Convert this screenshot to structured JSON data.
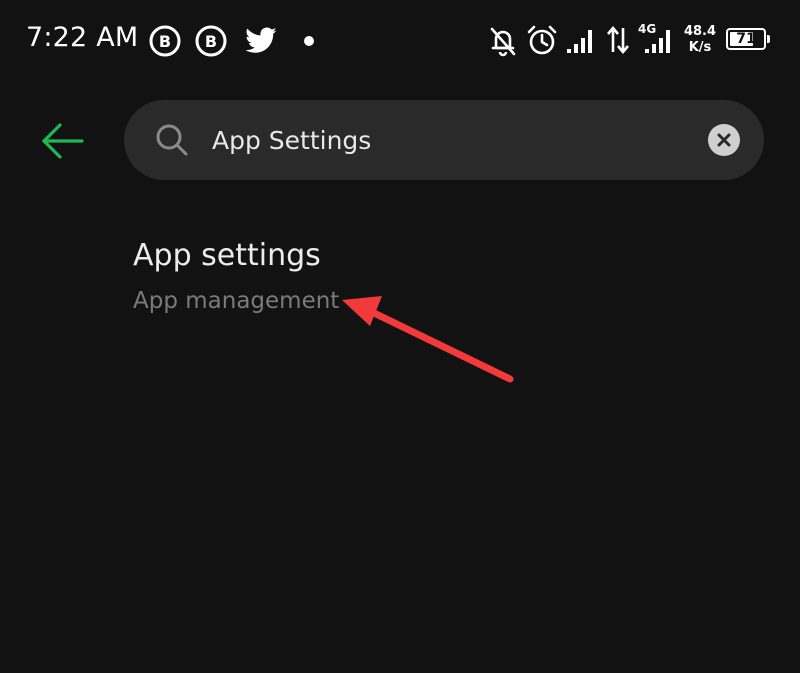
{
  "status_bar": {
    "time": "7:22 AM",
    "notification_icons": [
      "business-b-icon",
      "business-b-icon",
      "twitter-bird-icon",
      "more-dot-icon"
    ],
    "system_icons": [
      "bell-off-icon",
      "alarm-icon",
      "signal-bars-icon",
      "data-arrows-icon",
      "signal-bars-icon"
    ],
    "network_type": "4G",
    "network_speed_value": "48.4",
    "network_speed_unit": "K/s",
    "battery_level": "71",
    "battery_fraction": 0.71
  },
  "header": {
    "back_icon": "arrow-left-icon",
    "search": {
      "value": "App Settings",
      "search_icon": "magnifier-icon",
      "clear_icon": "close-circle-icon"
    }
  },
  "results": [
    {
      "title": "App settings",
      "subtitle": "App management"
    }
  ],
  "colors": {
    "background": "#121212",
    "search_bar": "#2a2a2a",
    "accent_green": "#1db954",
    "annotation_red": "#f33a3a"
  }
}
